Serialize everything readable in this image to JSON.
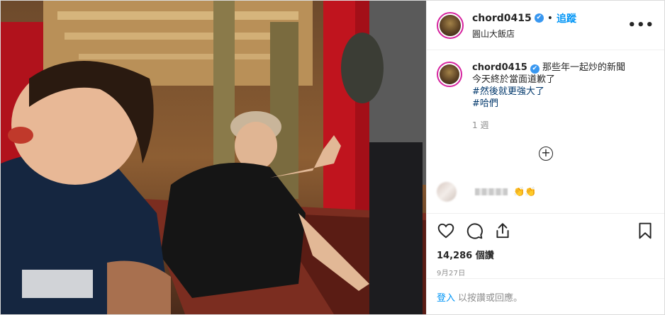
{
  "post": {
    "username": "chord0415",
    "verified_icon": "✔",
    "separator": "•",
    "follow_label": "追蹤",
    "location": "圓山大飯店",
    "more_icon": "•••"
  },
  "caption": {
    "username": "chord0415",
    "text": "那些年一起炒的新聞",
    "line2": "今天終於當面道歉了",
    "tags": [
      "#然後就更強大了",
      "#哈們"
    ],
    "time": "1 週"
  },
  "load_more_icon": "+",
  "blurred_comment": {
    "emoji": "👏👏"
  },
  "actions": {
    "icons": [
      "heart-icon",
      "comment-icon",
      "share-icon",
      "bookmark-icon"
    ],
    "views": "14,286 個讚",
    "date": "9月27日"
  },
  "login": {
    "link": "登入",
    "rest": "以按讚或回應。"
  },
  "colors": {
    "accent": "#0095f6",
    "verified": "#3897f0",
    "hashtag": "#00376b",
    "muted": "#8e8e8e"
  }
}
